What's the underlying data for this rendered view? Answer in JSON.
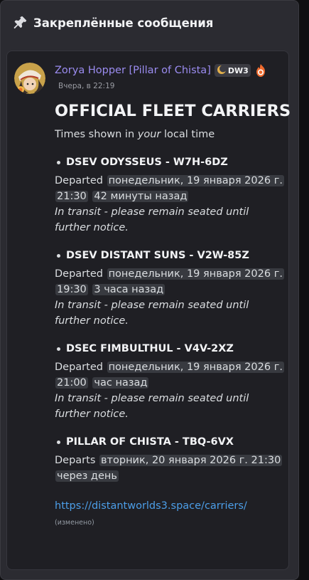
{
  "panel": {
    "title": "Закреплённые сообщения",
    "icon": "pin-icon"
  },
  "message": {
    "author": "Zorya Hopper [Pillar of Chista]",
    "tag": "DW3",
    "timestamp": "Вчера, в 22:19",
    "headline": "OFFICIAL FLEET CARRIERS",
    "intro_prefix": "Times shown in ",
    "intro_emphasis": "your",
    "intro_suffix": " local time",
    "entries": [
      {
        "title": "DSEV ODYSSEUS - W7H-6DZ",
        "label": "Departed",
        "date_part1": "понедельник, 19 января 2026 г.",
        "date_part2": "21:30",
        "relative": "42 минуты назад",
        "note": "In transit - please remain seated until further notice."
      },
      {
        "title": "DSEV DISTANT SUNS - V2W-85Z",
        "label": "Departed",
        "date_part1": "понедельник, 19 января 2026 г.",
        "date_part2": "19:30",
        "relative": "3 часа назад",
        "note": "In transit - please remain seated until further notice."
      },
      {
        "title": "DSEC FIMBULTHUL - V4V-2XZ",
        "label": "Departed",
        "date_part1": "понедельник, 19 января 2026 г.",
        "date_part2": "21:00",
        "relative": "час назад",
        "note": "In transit - please remain seated until further notice."
      },
      {
        "title": "PILLAR OF CHISTA - TBQ-6VX",
        "label": "Departs",
        "date_part1": "вторник, 20 января 2026 г. 21:30",
        "relative": "через день"
      }
    ],
    "link": "https://distantworlds3.space/carriers/",
    "edited": "(изменено)"
  },
  "colors": {
    "panel_bg": "#2b2b31",
    "card_bg": "#1f1f24",
    "author": "#9b8cf0",
    "link": "#4c9ee8",
    "text": "#dbdee1"
  }
}
